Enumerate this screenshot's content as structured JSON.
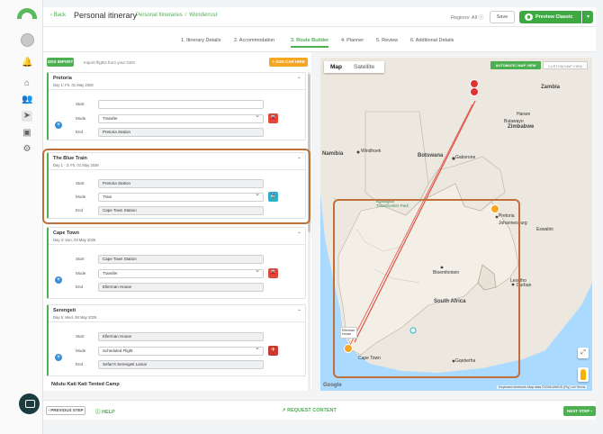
{
  "header": {
    "back_label": "Back",
    "title": "Personal itinerary",
    "breadcrumb": [
      "Personal Itineraries",
      "Wonderrust"
    ],
    "regions_label": "Regions: All",
    "save_label": "Save",
    "preview_label": "Preview Classic"
  },
  "steps": [
    "1. Itinerary Details",
    "2. Accommodation",
    "3. Route Builder",
    "4. Planner",
    "5. Review",
    "6. Additional Details"
  ],
  "active_step": "3. Route Builder",
  "toolbar": {
    "gds_label": "GDS IMPORT",
    "gds_hint": "Import flights from your GDS",
    "add_car_label": "+ ADD CAR HIRE"
  },
  "labels": {
    "start": "Start",
    "mode": "Mode",
    "end": "End"
  },
  "stops": [
    {
      "name": "Pretoria",
      "date": "Day 1: Fri, 01 May 2026",
      "start": "",
      "mode": "Transfer",
      "end": "Pretoria Station",
      "mode_icon": "car-icon"
    },
    {
      "name": "The Blue Train",
      "date": "Day 1 - 3: Fri, 01 May 2026",
      "start": "Pretoria Station",
      "mode": "Train",
      "end": "Cape Town Station",
      "mode_icon": "train-icon"
    },
    {
      "name": "Cape Town",
      "date": "Day 3: Sun, 03 May 2026",
      "start": "Cape Town Station",
      "mode": "Transfer",
      "end": "Ellerman House",
      "mode_icon": "car-icon"
    },
    {
      "name": "Serengeti",
      "date": "Day 6: Wed, 06 May 2026",
      "start": "Ellerman House",
      "mode": "Scheduled Flight",
      "end": "Sefari's Serengeti Lamai",
      "mode_icon": "plane-icon"
    }
  ],
  "next_stop_name": "Ndutu Kati Kati Tented Camp",
  "map": {
    "tab_map": "Map",
    "tab_satellite": "Satellite",
    "auto_view": "AUTOMATIC MAP VIEW",
    "custom_view": "CUSTOM MAP VIEW",
    "countries": [
      "Zambia",
      "Zimbabwe",
      "Botswana",
      "Namibia",
      "South Africa",
      "Lesotho",
      "Eswatini"
    ],
    "cities": [
      "Harare",
      "Bulawayo",
      "Windhoek",
      "Gaborone",
      "Pretoria",
      "Johannesburg",
      "Bloemfontein",
      "Durban",
      "Cape Town",
      "Gqeberha"
    ],
    "regions": [
      "Kgalagadi Transfrontier Park"
    ],
    "info_bubble": "Ellerman House",
    "google": "Google",
    "attribution": "Keyboard shortcuts   Map data ©2026 AfriGIS (Pty) Ltd   Terms"
  },
  "footer": {
    "prev_label": "PREVIOUS STEP",
    "help_label": "HELP",
    "request_label": "REQUEST CONTENT",
    "next_label": "NEXT STEP"
  },
  "colors": {
    "accent": "#4caf50",
    "highlight": "#c0703b",
    "route": "#e0483d"
  }
}
